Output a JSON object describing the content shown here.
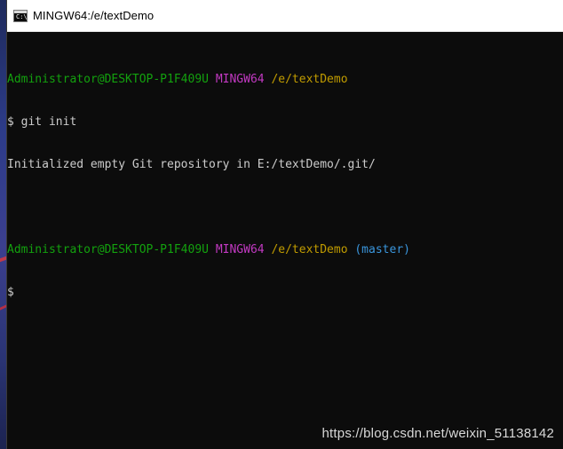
{
  "window": {
    "title": "MINGW64:/e/textDemo",
    "icon": "console-icon",
    "icon_glyph": "C:\\"
  },
  "terminal": {
    "lines": [
      {
        "user": "Administrator@DESKTOP-P1F409U",
        "system": "MINGW64",
        "path": "/e/textDemo"
      },
      {
        "text": "$ git init"
      },
      {
        "text": "Initialized empty Git repository in E:/textDemo/.git/"
      },
      {
        "user": "Administrator@DESKTOP-P1F409U",
        "system": "MINGW64",
        "path": "/e/textDemo",
        "branch": "(master)"
      },
      {
        "text": "$"
      }
    ]
  },
  "watermark": "https://blog.csdn.net/weixin_51138142",
  "colors": {
    "user": "#13a10e",
    "system": "#c239c2",
    "path": "#c19c00",
    "branch": "#3a96dd",
    "text": "#cccccc",
    "background": "#0c0c0c"
  }
}
